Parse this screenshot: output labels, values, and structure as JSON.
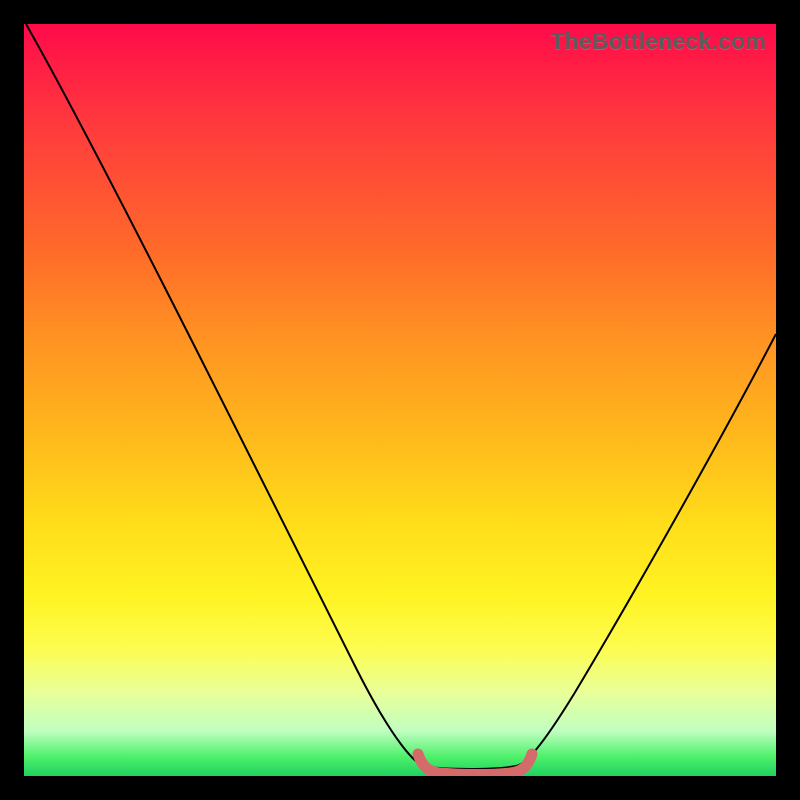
{
  "watermark": "TheBottleneck.com",
  "chart_data": {
    "type": "line",
    "title": "",
    "xlabel": "",
    "ylabel": "",
    "xlim": [
      0,
      100
    ],
    "ylim": [
      0,
      100
    ],
    "series": [
      {
        "name": "curve",
        "x": [
          0,
          5,
          10,
          15,
          20,
          25,
          30,
          35,
          40,
          45,
          50,
          53,
          56,
          59,
          62,
          65,
          68,
          72,
          76,
          80,
          84,
          88,
          92,
          96,
          100
        ],
        "values": [
          100,
          91,
          82,
          73,
          64,
          55,
          46,
          37,
          28,
          19,
          10,
          3,
          0,
          0,
          0,
          0,
          0,
          3,
          9,
          16,
          23,
          31,
          39,
          48,
          57
        ]
      },
      {
        "name": "valley-highlight",
        "x": [
          53,
          56,
          59,
          62,
          65,
          68
        ],
        "values": [
          2,
          0,
          0,
          0,
          0,
          2
        ]
      }
    ],
    "colors": {
      "curve": "#000000",
      "valley_highlight": "#d46a6a"
    },
    "grid": false,
    "legend": false
  }
}
